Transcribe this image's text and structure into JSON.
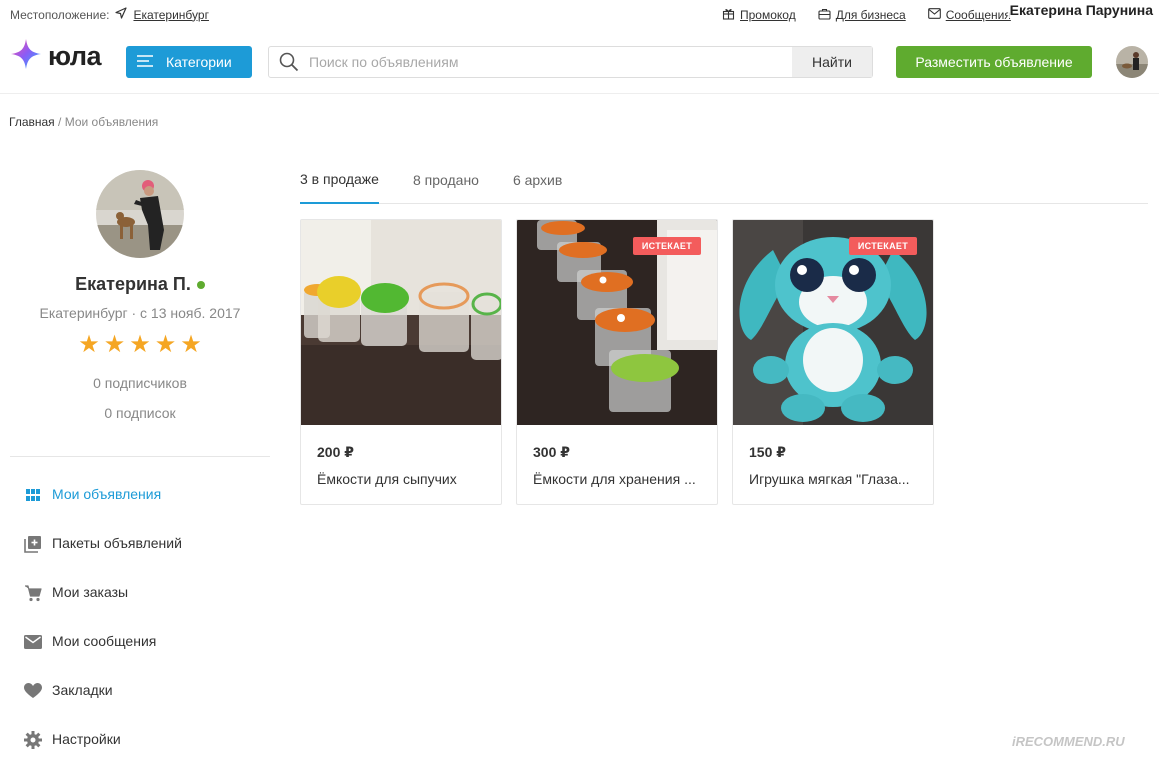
{
  "topbar": {
    "location_label": "Местоположение:",
    "city": "Екатеринбург",
    "links": [
      {
        "label": "Промокод",
        "icon": "gift-icon"
      },
      {
        "label": "Для бизнеса",
        "icon": "briefcase-icon"
      },
      {
        "label": "Сообщения",
        "icon": "envelope-icon"
      }
    ],
    "username_overlay": "Екатерина Парунина"
  },
  "header": {
    "logo_text": "юла",
    "categories_label": "Категории",
    "search_placeholder": "Поиск по объявлениям",
    "search_button": "Найти",
    "post_button": "Разместить объявление"
  },
  "breadcrumb": {
    "home": "Главная",
    "separator": " / ",
    "current": "Мои объявления"
  },
  "profile": {
    "name": "Екатерина П.",
    "meta": "Екатеринбург · с 13 нояб. 2017",
    "rating": 5,
    "star_glyph": "★",
    "followers": "0 подписчиков",
    "following": "0 подписок"
  },
  "menu": [
    {
      "label": "Мои объявления",
      "icon": "grid-icon",
      "active": true
    },
    {
      "label": "Пакеты объявлений",
      "icon": "stack-plus-icon",
      "active": false
    },
    {
      "label": "Мои заказы",
      "icon": "cart-icon",
      "active": false
    },
    {
      "label": "Мои сообщения",
      "icon": "envelope-icon",
      "active": false
    },
    {
      "label": "Закладки",
      "icon": "heart-icon",
      "active": false
    },
    {
      "label": "Настройки",
      "icon": "gear-icon",
      "active": false
    }
  ],
  "tabs": [
    {
      "label": "3 в продаже",
      "active": true
    },
    {
      "label": "8 продано",
      "active": false
    },
    {
      "label": "6 архив",
      "active": false
    }
  ],
  "listings": [
    {
      "price": "200 ₽",
      "title": "Ёмкости для сыпучих",
      "badge": ""
    },
    {
      "price": "300 ₽",
      "title": "Ёмкости для хранения ...",
      "badge": "ИСТЕКАЕТ"
    },
    {
      "price": "150 ₽",
      "title": "Игрушка мягкая \"Глаза...",
      "badge": "ИСТЕКАЕТ"
    }
  ],
  "watermark": "iRECOMMEND.RU",
  "colors": {
    "accent": "#1d9bd7",
    "post_button": "#5fab2f",
    "badge": "#f35c5c",
    "stars": "#f5a623"
  }
}
